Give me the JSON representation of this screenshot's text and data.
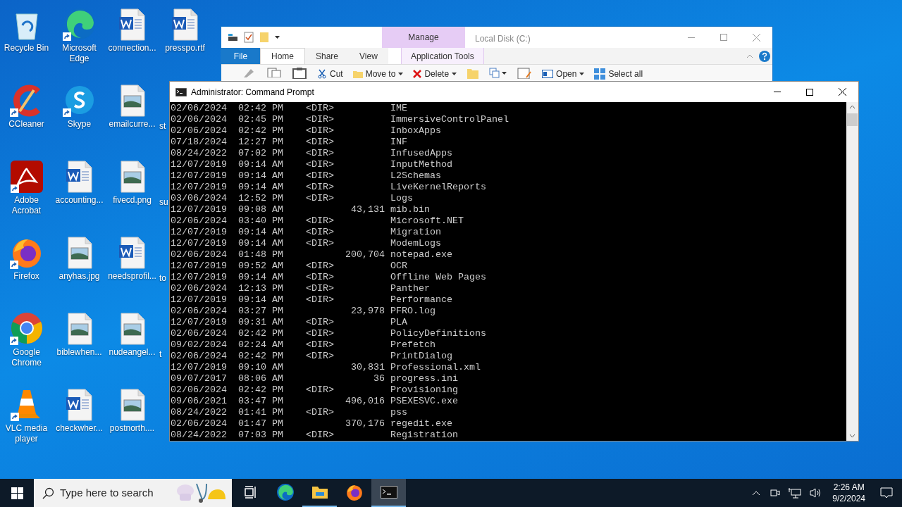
{
  "desktop_icons": [
    {
      "kind": "recycle",
      "label": "Recycle Bin"
    },
    {
      "kind": "ccleaner",
      "label": "CCleaner"
    },
    {
      "kind": "acrobat",
      "label": "Adobe Acrobat"
    },
    {
      "kind": "firefox",
      "label": "Firefox"
    },
    {
      "kind": "chrome",
      "label": "Google Chrome"
    },
    {
      "kind": "vlc",
      "label": "VLC media player"
    },
    {
      "kind": "edge",
      "label": "Microsoft Edge"
    },
    {
      "kind": "skype",
      "label": "Skype"
    },
    {
      "kind": "word",
      "label": "accounting..."
    },
    {
      "kind": "image",
      "label": "anyhas.jpg"
    },
    {
      "kind": "image",
      "label": "biblewhen..."
    },
    {
      "kind": "word",
      "label": "checkwher..."
    },
    {
      "kind": "word",
      "label": "connection..."
    },
    {
      "kind": "image",
      "label": "emailcurre..."
    },
    {
      "kind": "image",
      "label": "fivecd.png"
    },
    {
      "kind": "word",
      "label": "needsprofil..."
    },
    {
      "kind": "image",
      "label": "nudeangel..."
    },
    {
      "kind": "image",
      "label": "postnorth...."
    },
    {
      "kind": "word",
      "label": "presspo.rtf"
    },
    {
      "kind": "covered",
      "label": "st"
    },
    {
      "kind": "covered",
      "label": "su"
    },
    {
      "kind": "covered",
      "label": "to"
    },
    {
      "kind": "covered",
      "label": "t"
    }
  ],
  "explorer": {
    "contextual_header": "Manage",
    "title": "Local Disk (C:)",
    "tabs": [
      {
        "label": "File",
        "kind": "file",
        "selected": false
      },
      {
        "label": "Home",
        "kind": "tab",
        "selected": true
      },
      {
        "label": "Share",
        "kind": "tab",
        "selected": false
      },
      {
        "label": "View",
        "kind": "tab",
        "selected": false
      },
      {
        "label": "Application Tools",
        "kind": "contextual",
        "selected": false
      }
    ],
    "ribbon": [
      {
        "kind": "paste"
      },
      {
        "kind": "copy"
      },
      {
        "kind": "clipboard"
      },
      {
        "kind": "cut",
        "label": "Cut"
      },
      {
        "kind": "folder",
        "label": "Move to",
        "dropdown": true
      },
      {
        "kind": "delete",
        "label": "Delete",
        "dropdown": true
      },
      {
        "kind": "newfolder"
      },
      {
        "kind": "copyto",
        "dropdown": true
      },
      {
        "kind": "properties"
      },
      {
        "kind": "open",
        "label": "Open",
        "dropdown": true
      },
      {
        "kind": "select",
        "label": "Select all"
      }
    ]
  },
  "console": {
    "title": "Administrator: Command Prompt",
    "rows": [
      {
        "date": "02/06/2024",
        "time": "02:42 PM",
        "kind": "dir",
        "size": "<DIR>",
        "name": "IME"
      },
      {
        "date": "02/06/2024",
        "time": "02:45 PM",
        "kind": "dir",
        "size": "<DIR>",
        "name": "ImmersiveControlPanel"
      },
      {
        "date": "02/06/2024",
        "time": "02:42 PM",
        "kind": "dir",
        "size": "<DIR>",
        "name": "InboxApps"
      },
      {
        "date": "07/18/2024",
        "time": "12:27 PM",
        "kind": "dir",
        "size": "<DIR>",
        "name": "INF"
      },
      {
        "date": "08/24/2022",
        "time": "07:02 PM",
        "kind": "dir",
        "size": "<DIR>",
        "name": "InfusedApps"
      },
      {
        "date": "12/07/2019",
        "time": "09:14 AM",
        "kind": "dir",
        "size": "<DIR>",
        "name": "InputMethod"
      },
      {
        "date": "12/07/2019",
        "time": "09:14 AM",
        "kind": "dir",
        "size": "<DIR>",
        "name": "L2Schemas"
      },
      {
        "date": "12/07/2019",
        "time": "09:14 AM",
        "kind": "dir",
        "size": "<DIR>",
        "name": "LiveKernelReports"
      },
      {
        "date": "03/06/2024",
        "time": "12:52 PM",
        "kind": "dir",
        "size": "<DIR>",
        "name": "Logs"
      },
      {
        "date": "12/07/2019",
        "time": "09:08 AM",
        "kind": "file",
        "size": "43,131",
        "name": "mib.bin"
      },
      {
        "date": "02/06/2024",
        "time": "03:40 PM",
        "kind": "dir",
        "size": "<DIR>",
        "name": "Microsoft.NET"
      },
      {
        "date": "12/07/2019",
        "time": "09:14 AM",
        "kind": "dir",
        "size": "<DIR>",
        "name": "Migration"
      },
      {
        "date": "12/07/2019",
        "time": "09:14 AM",
        "kind": "dir",
        "size": "<DIR>",
        "name": "ModemLogs"
      },
      {
        "date": "02/06/2024",
        "time": "01:48 PM",
        "kind": "file",
        "size": "200,704",
        "name": "notepad.exe"
      },
      {
        "date": "12/07/2019",
        "time": "09:52 AM",
        "kind": "dir",
        "size": "<DIR>",
        "name": "OCR"
      },
      {
        "date": "12/07/2019",
        "time": "09:14 AM",
        "kind": "dir",
        "size": "<DIR>",
        "name": "Offline Web Pages"
      },
      {
        "date": "02/06/2024",
        "time": "12:13 PM",
        "kind": "dir",
        "size": "<DIR>",
        "name": "Panther"
      },
      {
        "date": "12/07/2019",
        "time": "09:14 AM",
        "kind": "dir",
        "size": "<DIR>",
        "name": "Performance"
      },
      {
        "date": "02/06/2024",
        "time": "03:27 PM",
        "kind": "file",
        "size": "23,978",
        "name": "PFRO.log"
      },
      {
        "date": "12/07/2019",
        "time": "09:31 AM",
        "kind": "dir",
        "size": "<DIR>",
        "name": "PLA"
      },
      {
        "date": "02/06/2024",
        "time": "02:42 PM",
        "kind": "dir",
        "size": "<DIR>",
        "name": "PolicyDefinitions"
      },
      {
        "date": "09/02/2024",
        "time": "02:24 AM",
        "kind": "dir",
        "size": "<DIR>",
        "name": "Prefetch"
      },
      {
        "date": "02/06/2024",
        "time": "02:42 PM",
        "kind": "dir",
        "size": "<DIR>",
        "name": "PrintDialog"
      },
      {
        "date": "12/07/2019",
        "time": "09:10 AM",
        "kind": "file",
        "size": "30,831",
        "name": "Professional.xml"
      },
      {
        "date": "09/07/2017",
        "time": "08:06 AM",
        "kind": "file",
        "size": "36",
        "name": "progress.ini"
      },
      {
        "date": "02/06/2024",
        "time": "02:42 PM",
        "kind": "dir",
        "size": "<DIR>",
        "name": "Provisioning"
      },
      {
        "date": "09/06/2021",
        "time": "03:47 PM",
        "kind": "file",
        "size": "496,016",
        "name": "PSEXESVC.exe"
      },
      {
        "date": "08/24/2022",
        "time": "01:41 PM",
        "kind": "dir",
        "size": "<DIR>",
        "name": "pss"
      },
      {
        "date": "02/06/2024",
        "time": "01:47 PM",
        "kind": "file",
        "size": "370,176",
        "name": "regedit.exe"
      },
      {
        "date": "08/24/2022",
        "time": "07:03 PM",
        "kind": "dir",
        "size": "<DIR>",
        "name": "Registration"
      }
    ]
  },
  "taskbar": {
    "search": {
      "placeholder": "Type here to search"
    },
    "apps": [
      {
        "kind": "taskview",
        "running": false,
        "selected": false
      },
      {
        "kind": "edge",
        "running": false,
        "selected": false
      },
      {
        "kind": "explorer",
        "running": true,
        "selected": false
      },
      {
        "kind": "firefox",
        "running": false,
        "selected": false
      },
      {
        "kind": "console",
        "running": true,
        "selected": true
      }
    ],
    "time": "2:26 AM",
    "date": "9/2/2024"
  }
}
